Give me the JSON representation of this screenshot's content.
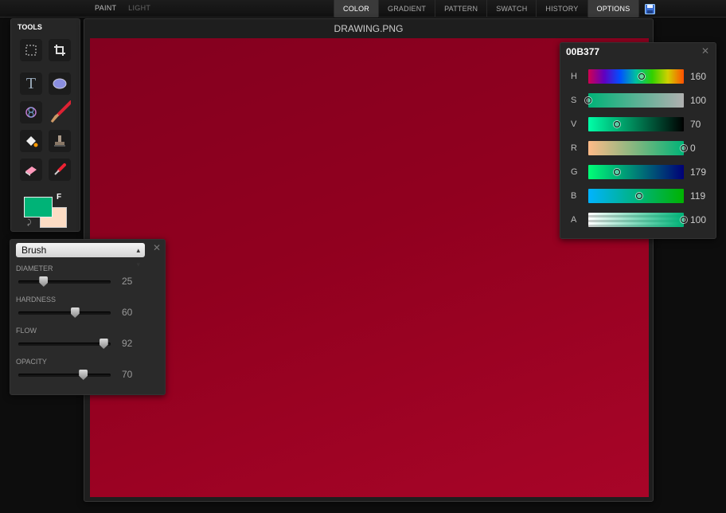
{
  "top_menu": {
    "paint": "PAINT",
    "light": "LIGHT"
  },
  "tabs": [
    {
      "label": "COLOR",
      "active": true
    },
    {
      "label": "GRADIENT",
      "active": false
    },
    {
      "label": "PATTERN",
      "active": false
    },
    {
      "label": "SWATCH",
      "active": false
    },
    {
      "label": "HISTORY",
      "active": false
    },
    {
      "label": "OPTIONS",
      "active": true
    }
  ],
  "save_icon": "floppy-disk-icon",
  "tools": {
    "title": "TOOLS",
    "items": [
      "marquee-select",
      "crop",
      "text",
      "ellipse",
      "spirograph",
      "brush",
      "paint-bucket",
      "stamp",
      "eraser",
      "eyedropper"
    ],
    "foreground_color": "#00B377",
    "background_color": "#FCDCC4",
    "fg_letter": "F"
  },
  "canvas": {
    "title": "DRAWING.PNG",
    "fill_color": "#91001F"
  },
  "brush_panel": {
    "selected": "Brush",
    "sliders": [
      {
        "label": "DIAMETER",
        "value": "25",
        "fraction": 0.27
      },
      {
        "label": "HARDNESS",
        "value": "60",
        "fraction": 0.61
      },
      {
        "label": "FLOW",
        "value": "92",
        "fraction": 0.92
      },
      {
        "label": "OPACITY",
        "value": "70",
        "fraction": 0.7
      }
    ]
  },
  "color_panel": {
    "hex": "00B377",
    "channels": [
      {
        "label": "H",
        "value": "160",
        "fraction": 0.56
      },
      {
        "label": "S",
        "value": "100",
        "fraction": 0.0
      },
      {
        "label": "V",
        "value": "70",
        "fraction": 0.3
      },
      {
        "label": "R",
        "value": "0",
        "fraction": 1.0
      },
      {
        "label": "G",
        "value": "179",
        "fraction": 0.3
      },
      {
        "label": "B",
        "value": "119",
        "fraction": 0.53
      },
      {
        "label": "A",
        "value": "100",
        "fraction": 1.0
      }
    ]
  }
}
